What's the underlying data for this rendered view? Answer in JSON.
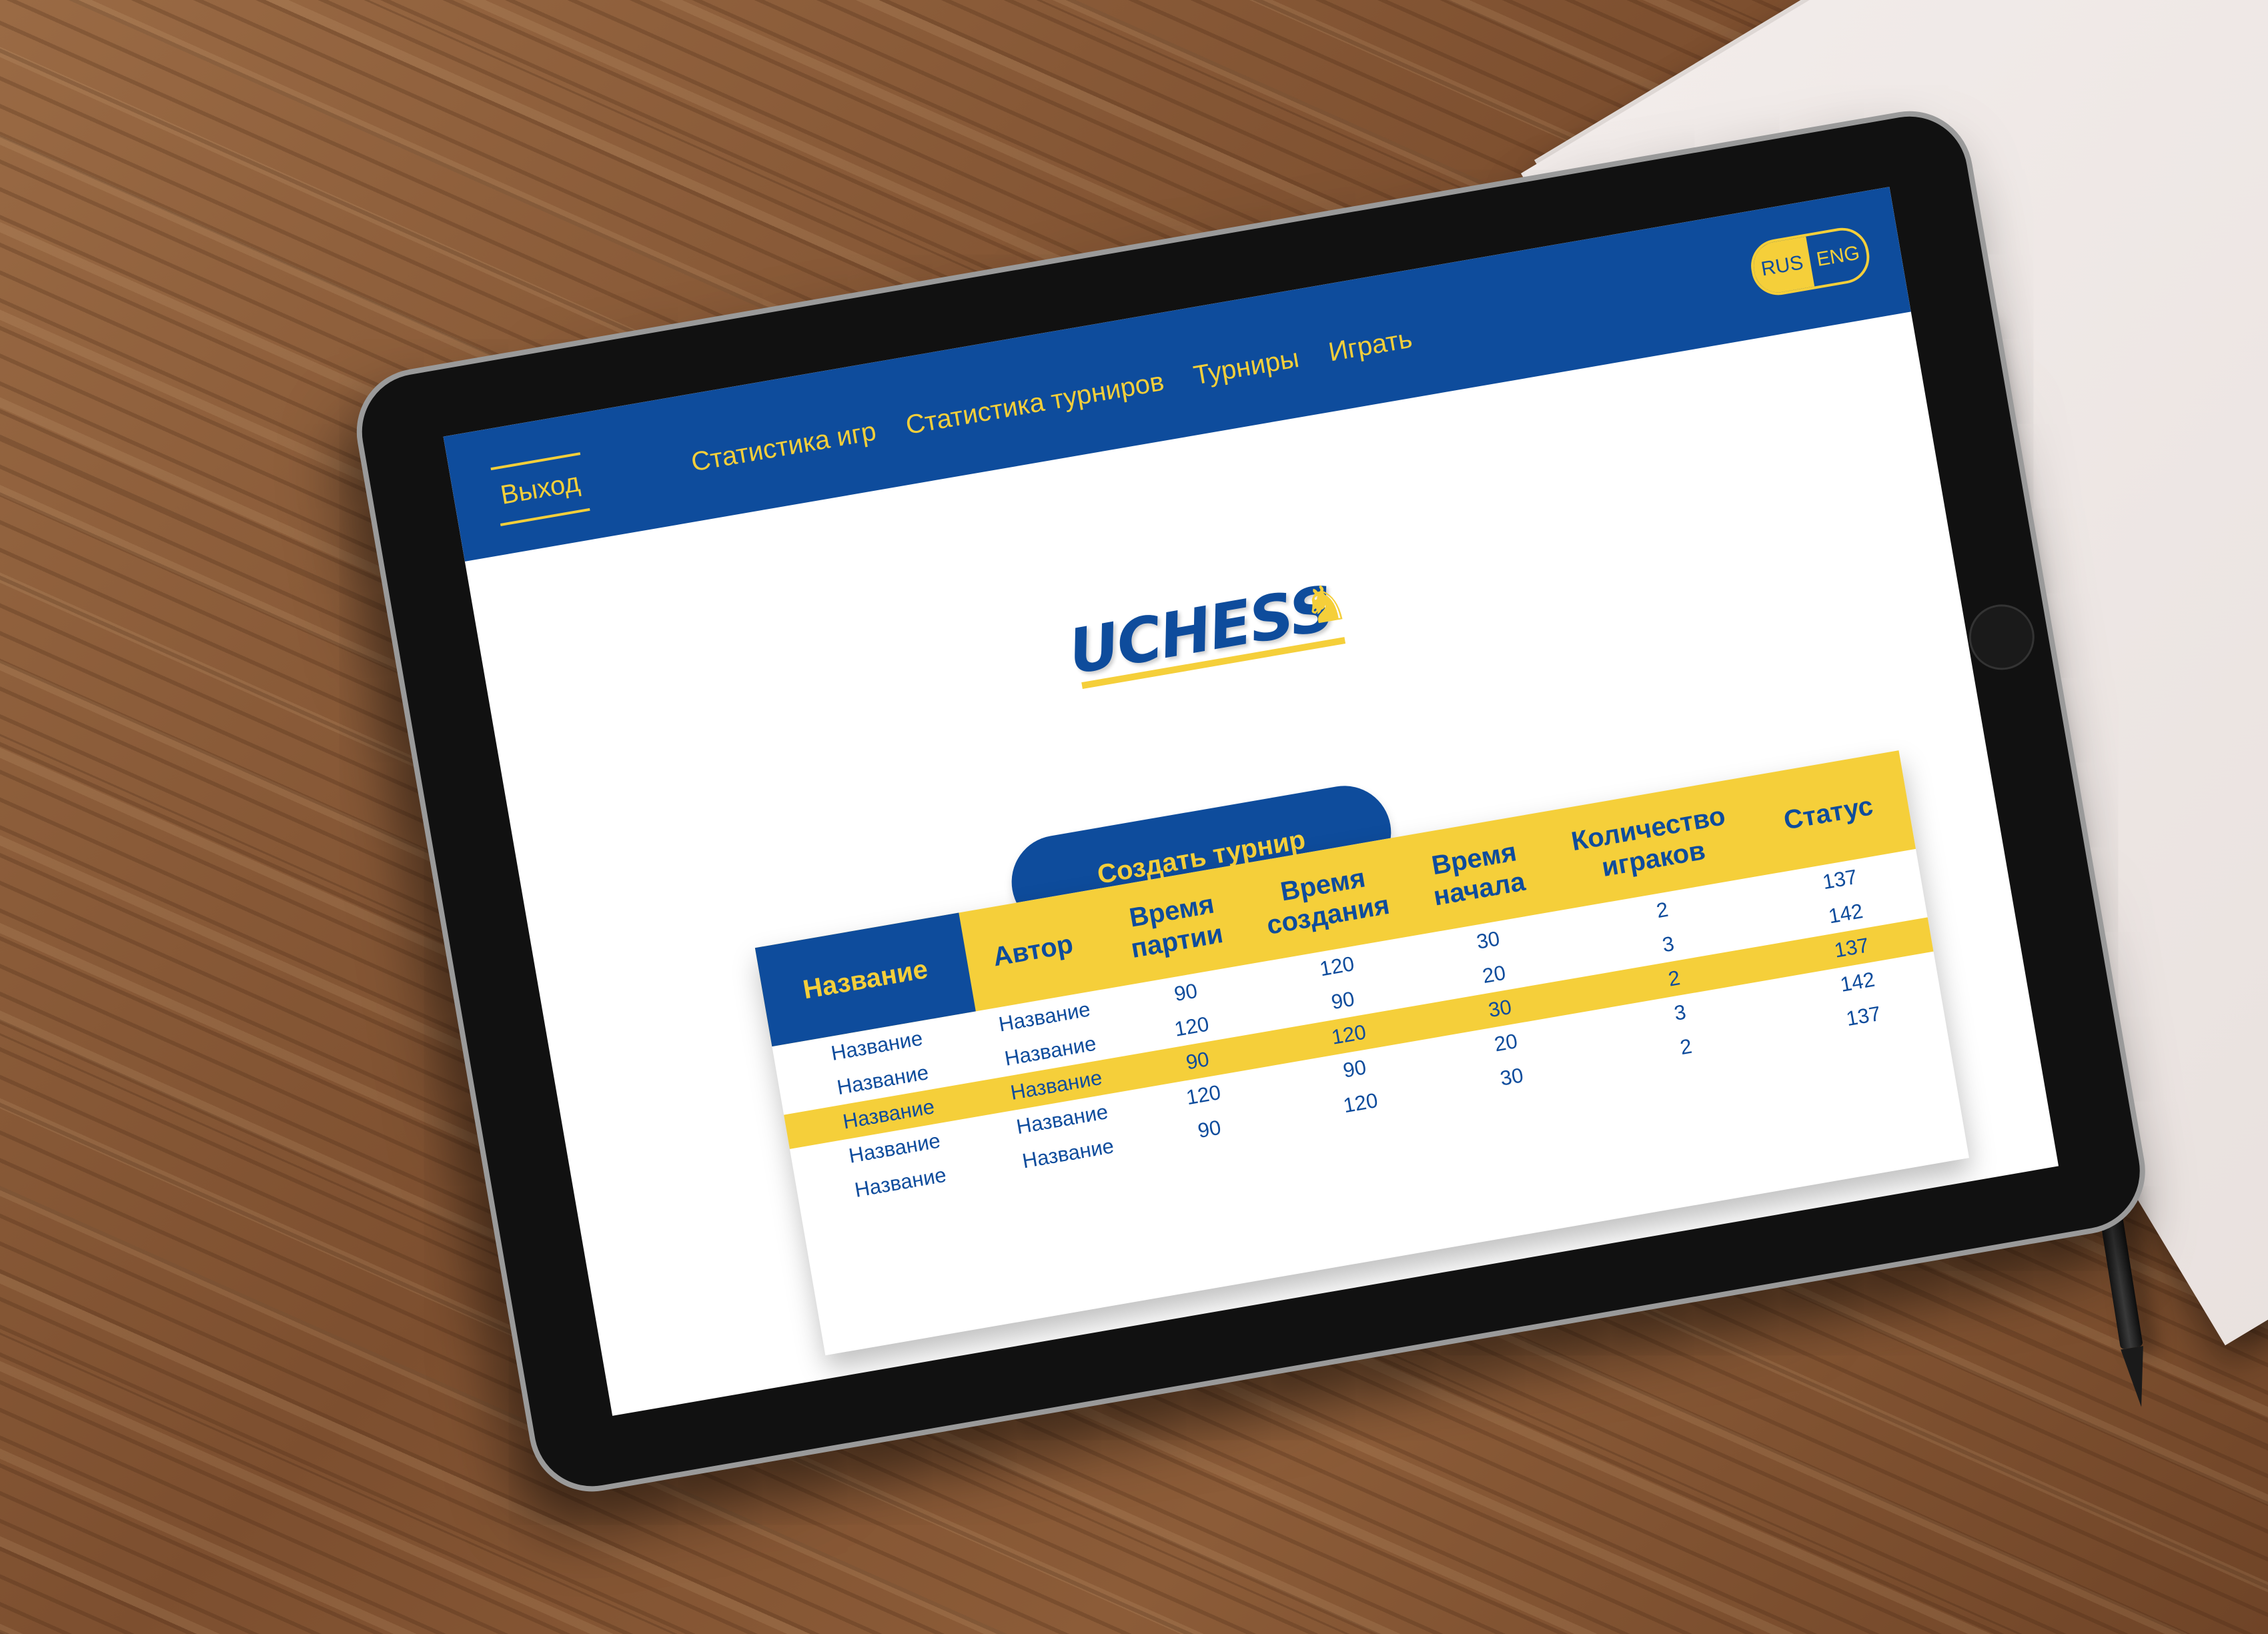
{
  "navbar": {
    "logout_label": "Выход",
    "links": [
      "Статистика игр",
      "Статистика турниров",
      "Турниры",
      "Играть"
    ],
    "lang": {
      "ru": "RUS",
      "en": "ENG"
    }
  },
  "logo": {
    "text": "UCHESS",
    "icon": "horse-icon"
  },
  "create_button_label": "Создать турнир",
  "table": {
    "headers": [
      "Название",
      "Автор",
      "Время партии",
      "Время создания",
      "Время начала",
      "Количество играков",
      "Статус"
    ],
    "rows": [
      [
        "Название",
        "Название",
        "90",
        "120",
        "30",
        "2",
        "137"
      ],
      [
        "Название",
        "Название",
        "120",
        "90",
        "20",
        "3",
        "142"
      ],
      [
        "Название",
        "Название",
        "90",
        "120",
        "30",
        "2",
        "137"
      ],
      [
        "Название",
        "Название",
        "120",
        "90",
        "20",
        "3",
        "142"
      ],
      [
        "Название",
        "Название",
        "90",
        "120",
        "30",
        "2",
        "137"
      ]
    ],
    "highlighted_row_index": 2
  },
  "colors": {
    "primary": "#0e4c9c",
    "accent": "#f5cf3a"
  }
}
